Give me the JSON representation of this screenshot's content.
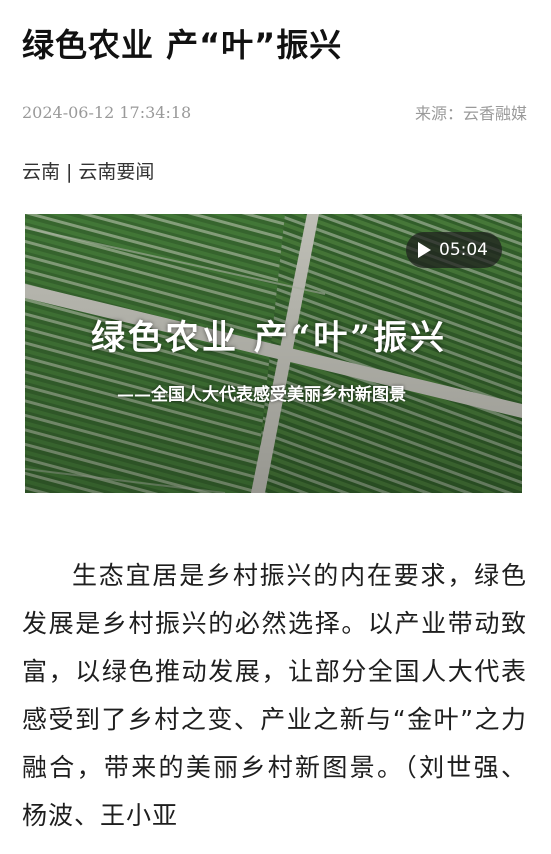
{
  "article": {
    "title": "绿色农业 产“叶”振兴",
    "date": "2024-06-12 17:34:18",
    "source": "来源：云香融媒",
    "category_primary": "云南",
    "category_separator": "|",
    "category_secondary": "云南要闻",
    "body": "生态宜居是乡村振兴的内在要求，绿色发展是乡村振兴的必然选择。以产业带动致富，以绿色推动发展，让部分全国人大代表感受到了乡村之变、产业之新与“金叶”之力融合，带来的美丽乡村新图景。（刘世强、杨波、王小亚"
  },
  "video": {
    "overlay_title": "绿色农业  产“叶”振兴",
    "overlay_subtitle": "——全国人大代表感受美丽乡村新图景",
    "duration": "05:04",
    "play_icon": "play-icon"
  },
  "colors": {
    "field_green": "#2f5b2a",
    "road": "#c9c9c0",
    "meta_gray": "#9a9a9a"
  }
}
